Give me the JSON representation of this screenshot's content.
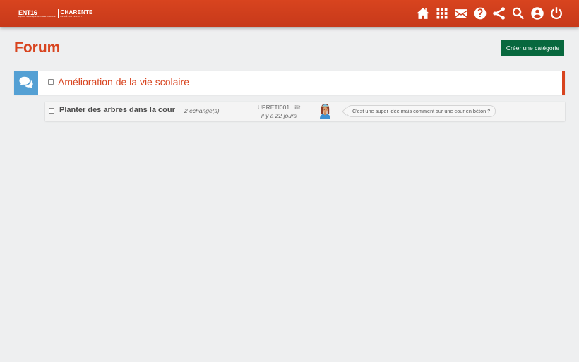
{
  "header": {
    "logo": {
      "ent": "ENT16",
      "ent_sub": "Espace Numérique de Travail Charente",
      "dept": "CHARENTE",
      "dept_sub": "LE DÉPARTEMENT"
    },
    "nav_icons": [
      "home-icon",
      "apps-icon",
      "mail-icon",
      "help-icon",
      "share-icon",
      "search-icon",
      "account-icon",
      "power-icon"
    ]
  },
  "page": {
    "title": "Forum",
    "create_button": "Créer une catégorie"
  },
  "categories": [
    {
      "title": "Amélioration de la vie scolaire",
      "icon": "chat-bubbles-icon",
      "subjects": [
        {
          "title": "Planter des arbres dans la cour",
          "count": "2 échange(s)",
          "author": "UPRETI001 Lilit",
          "when": "il y a 22 jours",
          "last_message": "C'est une super idée mais comment sur une cour en béton ?"
        }
      ]
    }
  ],
  "colors": {
    "accent": "#d8441f",
    "button": "#08683e",
    "category_icon_bg": "#54a0d4",
    "background": "#eeeff0"
  }
}
